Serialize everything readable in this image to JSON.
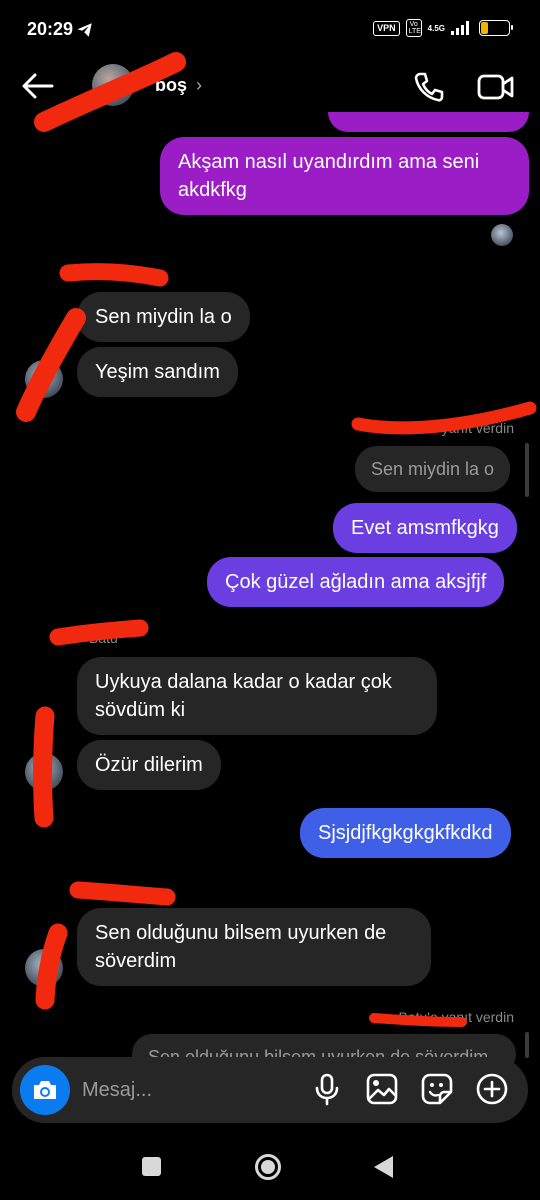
{
  "status_bar": {
    "time": "20:29",
    "vpn": "VPN",
    "volte": "Vo LTE",
    "network": "4.5G",
    "battery": "25",
    "battery_level": 0.25
  },
  "header": {
    "contact_name": "boş",
    "chevron": "›"
  },
  "messages": {
    "m1": "Akşam nasıl uyandırdım ama seni akdkfkg",
    "m2": "Sen miydin la o",
    "m3": "Yeşim sandım",
    "reply_note_1": "Batu'e yanıt verdin",
    "quote_1": "Sen miydin la o",
    "m4": "Evet amsmfkgkg",
    "m5": "Çok güzel ağladın ama aksjfjf",
    "sender_1": "Batu",
    "m6": "Uykuya dalana kadar o kadar çok sövdüm ki",
    "m7": "Özür dilerim",
    "m8": "Sjsjdjfkgkgkgkfkdkd",
    "m9": "Sen olduğunu bilsem uyurken de söverdim",
    "reply_note_2": "Batu'e yanıt verdin",
    "quote_2": "Sen olduğunu bilsem uyurken de söverdim"
  },
  "composer": {
    "placeholder": "Mesaj..."
  },
  "icons": {
    "back": "back-arrow-icon",
    "call": "phone-icon",
    "video": "video-camera-icon",
    "camera": "camera-icon",
    "mic": "microphone-icon",
    "gallery": "image-icon",
    "sticker": "sticker-icon",
    "more": "plus-circle-icon"
  },
  "colors": {
    "outgoing_purple": "#9a1dc6",
    "outgoing_violet": "#6a3ee0",
    "outgoing_blue": "#3f5fe6",
    "incoming": "#262626",
    "camera_button": "#0a7cf0",
    "redaction": "#f0290f"
  }
}
